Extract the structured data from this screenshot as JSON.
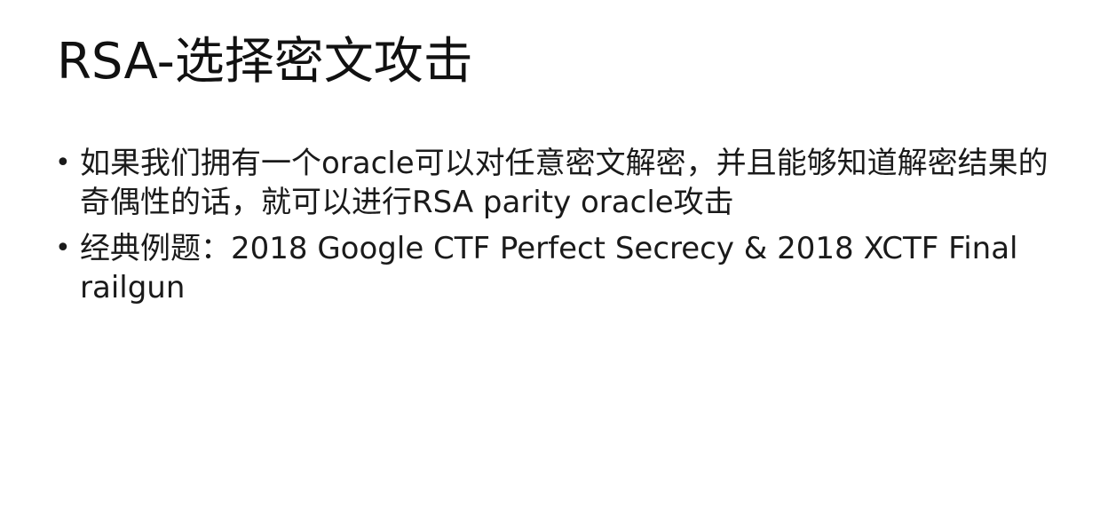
{
  "slide": {
    "title": "RSA-选择密文攻击",
    "bullets": [
      {
        "marker": "•",
        "text": "如果我们拥有一个oracle可以对任意密文解密，并且能够知道解密结果的奇偶性的话，就可以进行RSA parity oracle攻击"
      },
      {
        "marker": "•",
        "text": "经典例题：2018 Google CTF Perfect Secrecy & 2018 XCTF Final railgun"
      }
    ]
  }
}
